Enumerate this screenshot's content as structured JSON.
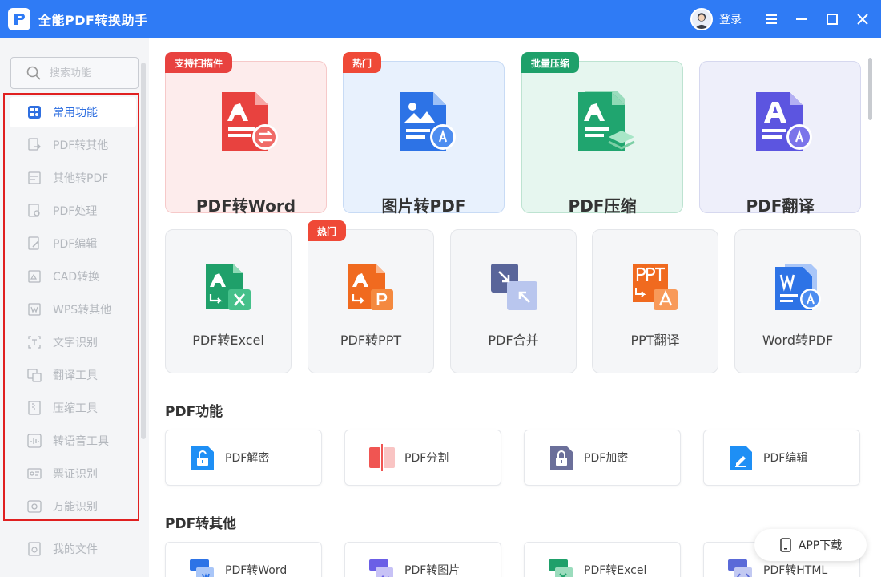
{
  "app": {
    "title": "全能PDF转换助手",
    "login": "登录"
  },
  "colors": {
    "accent": "#2f7bf5",
    "highlight_border": "#e02020"
  },
  "search": {
    "placeholder": "搜索功能"
  },
  "sidebar": {
    "items": [
      {
        "label": "常用功能",
        "icon": "grid-icon",
        "active": true
      },
      {
        "label": "PDF转其他",
        "icon": "pdf-convert-icon"
      },
      {
        "label": "其他转PDF",
        "icon": "to-pdf-icon"
      },
      {
        "label": "PDF处理",
        "icon": "pdf-process-icon"
      },
      {
        "label": "PDF编辑",
        "icon": "pdf-edit-icon"
      },
      {
        "label": "CAD转换",
        "icon": "cad-icon"
      },
      {
        "label": "WPS转其他",
        "icon": "wps-icon"
      },
      {
        "label": "文字识别",
        "icon": "ocr-icon"
      },
      {
        "label": "翻译工具",
        "icon": "translate-icon"
      },
      {
        "label": "压缩工具",
        "icon": "compress-icon"
      },
      {
        "label": "转语音工具",
        "icon": "voice-icon"
      },
      {
        "label": "票证识别",
        "icon": "ticket-icon"
      },
      {
        "label": "万能识别",
        "icon": "scan-icon"
      }
    ],
    "my_files": "我的文件"
  },
  "big_cards": [
    {
      "label": "PDF转Word",
      "tag": "支持扫描件"
    },
    {
      "label": "图片转PDF",
      "tag": "热门"
    },
    {
      "label": "PDF压缩",
      "tag": "批量压缩"
    },
    {
      "label": "PDF翻译",
      "tag": ""
    }
  ],
  "mid_cards": [
    {
      "label": "PDF转Excel",
      "tag": ""
    },
    {
      "label": "PDF转PPT",
      "tag": "热门"
    },
    {
      "label": "PDF合并",
      "tag": ""
    },
    {
      "label": "PPT翻译",
      "tag": ""
    },
    {
      "label": "Word转PDF",
      "tag": ""
    }
  ],
  "sections": [
    {
      "title": "PDF功能",
      "items": [
        "PDF解密",
        "PDF分割",
        "PDF加密",
        "PDF编辑"
      ]
    },
    {
      "title": "PDF转其他",
      "items": [
        "PDF转Word",
        "PDF转图片",
        "PDF转Excel",
        "PDF转HTML"
      ]
    }
  ],
  "app_download": "APP下载"
}
